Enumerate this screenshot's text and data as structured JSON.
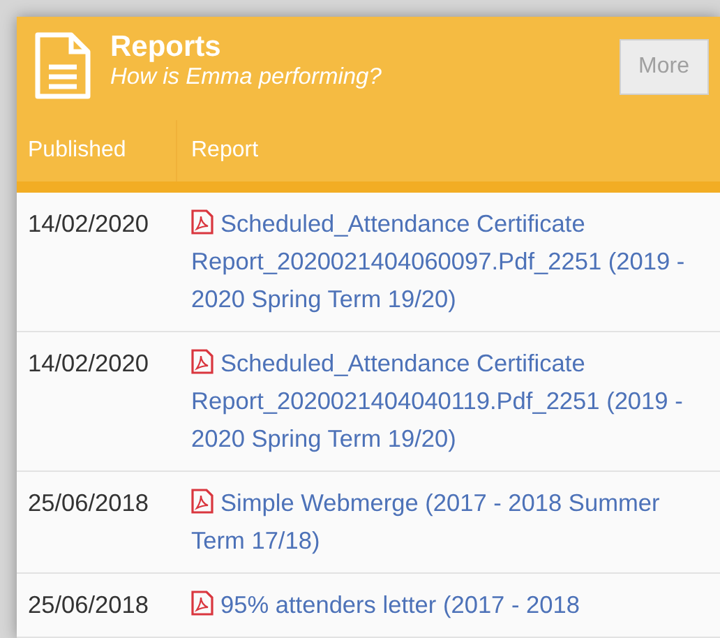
{
  "panel": {
    "title": "Reports",
    "subtitle": "How is Emma performing?",
    "more_button": "More"
  },
  "table": {
    "columns": [
      "Published",
      "Report"
    ],
    "rows": [
      {
        "published": "14/02/2020",
        "report": "Scheduled_Attendance Certificate Report_2020021404060097.Pdf_2251 (2019 - 2020 Spring Term 19/20)"
      },
      {
        "published": "14/02/2020",
        "report": "Scheduled_Attendance Certificate Report_2020021404040119.Pdf_2251 (2019 - 2020 Spring Term 19/20)"
      },
      {
        "published": "25/06/2018",
        "report": "Simple Webmerge (2017 - 2018 Summer Term 17/18)"
      },
      {
        "published": "25/06/2018",
        "report": "95% attenders letter (2017 - 2018"
      }
    ]
  }
}
